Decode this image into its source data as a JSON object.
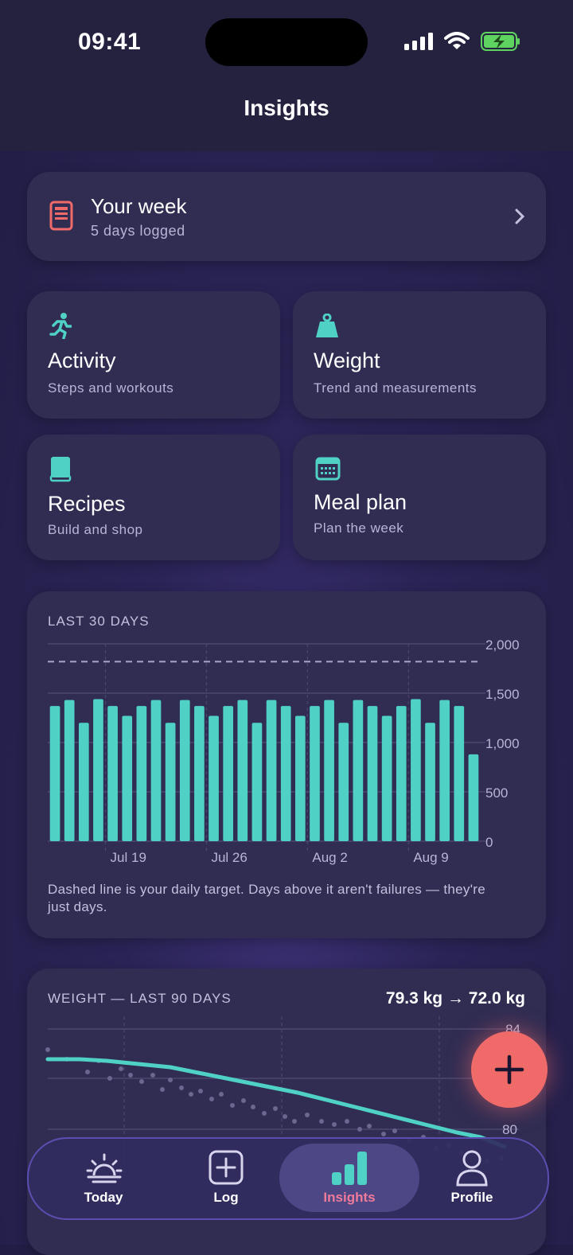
{
  "status": {
    "time": "09:41"
  },
  "header": {
    "title": "Insights"
  },
  "week_card": {
    "title": "Your week",
    "subtitle": "5 days logged"
  },
  "tiles": [
    {
      "title": "Activity",
      "subtitle": "Steps and workouts",
      "icon": "running-person-icon"
    },
    {
      "title": "Weight",
      "subtitle": "Trend and measurements",
      "icon": "weight-icon"
    },
    {
      "title": "Recipes",
      "subtitle": "Build and shop",
      "icon": "book-icon"
    },
    {
      "title": "Meal plan",
      "subtitle": "Plan the week",
      "icon": "calendar-icon"
    }
  ],
  "calorie_chart": {
    "label": "LAST 30 DAYS",
    "note": "Dashed line is your daily target. Days above it aren't failures — they're just days."
  },
  "weight_chart": {
    "label": "WEIGHT — LAST 90 DAYS",
    "summary": "79.3 kg → 72.0 kg"
  },
  "tabs": [
    {
      "label": "Today",
      "icon": "sunrise-icon"
    },
    {
      "label": "Log",
      "icon": "plus-square-icon"
    },
    {
      "label": "Insights",
      "icon": "bar-chart-icon"
    },
    {
      "label": "Profile",
      "icon": "person-icon"
    }
  ],
  "colors": {
    "accent": "#4fd1c5",
    "fab": "#f06a6a",
    "active_tab_text": "#f07a9a"
  },
  "chart_data": [
    {
      "type": "bar",
      "ylim": [
        0,
        2000
      ],
      "yticks": [
        "2,000",
        "1,500",
        "1,000",
        "500",
        "0"
      ],
      "xticks": [
        "Jul 19",
        "Jul 26",
        "Aug 2",
        "Aug 9"
      ],
      "target": 1820,
      "values": [
        1370,
        1430,
        1200,
        1440,
        1370,
        1270,
        1370,
        1430,
        1200,
        1430,
        1370,
        1270,
        1370,
        1430,
        1200,
        1430,
        1370,
        1270,
        1370,
        1430,
        1200,
        1430,
        1370,
        1270,
        1370,
        1440,
        1200,
        1430,
        1370,
        880
      ]
    },
    {
      "type": "line",
      "yticks": [
        "84",
        "80"
      ],
      "ylim": [
        78,
        84
      ]
    }
  ]
}
